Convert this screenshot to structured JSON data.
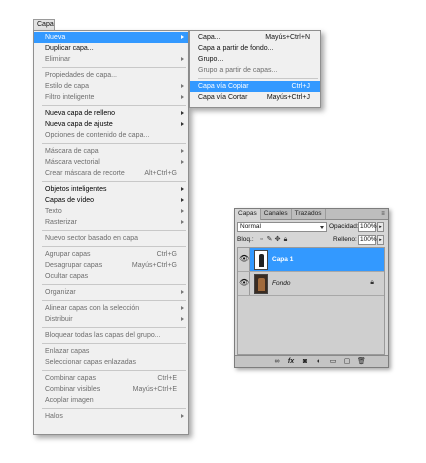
{
  "menubar": {
    "label": "Capa"
  },
  "main_menu": {
    "items": [
      {
        "label": "Nueva",
        "shortcut": "",
        "arrow": true,
        "state": "hl"
      },
      {
        "label": "Duplicar capa...",
        "shortcut": "",
        "arrow": false,
        "state": "enabled"
      },
      {
        "label": "Eliminar",
        "shortcut": "",
        "arrow": true,
        "state": "disabled"
      },
      {
        "sep": true
      },
      {
        "label": "Propiedades de capa...",
        "shortcut": "",
        "arrow": false,
        "state": "disabled"
      },
      {
        "label": "Estilo de capa",
        "shortcut": "",
        "arrow": true,
        "state": "disabled"
      },
      {
        "label": "Filtro inteligente",
        "shortcut": "",
        "arrow": true,
        "state": "disabled"
      },
      {
        "sep": true
      },
      {
        "label": "Nueva capa de relleno",
        "shortcut": "",
        "arrow": true,
        "state": "strong"
      },
      {
        "label": "Nueva capa de ajuste",
        "shortcut": "",
        "arrow": true,
        "state": "strong"
      },
      {
        "label": "Opciones de contenido de capa...",
        "shortcut": "",
        "arrow": false,
        "state": "disabled"
      },
      {
        "sep": true
      },
      {
        "label": "Máscara de capa",
        "shortcut": "",
        "arrow": true,
        "state": "disabled"
      },
      {
        "label": "Máscara vectorial",
        "shortcut": "",
        "arrow": true,
        "state": "disabled"
      },
      {
        "label": "Crear máscara de recorte",
        "shortcut": "Alt+Ctrl+G",
        "arrow": false,
        "state": "disabled"
      },
      {
        "sep": true
      },
      {
        "label": "Objetos inteligentes",
        "shortcut": "",
        "arrow": true,
        "state": "strong"
      },
      {
        "label": "Capas de vídeo",
        "shortcut": "",
        "arrow": true,
        "state": "strong"
      },
      {
        "label": "Texto",
        "shortcut": "",
        "arrow": true,
        "state": "disabled"
      },
      {
        "label": "Rasterizar",
        "shortcut": "",
        "arrow": true,
        "state": "disabled"
      },
      {
        "sep": true
      },
      {
        "label": "Nuevo sector basado en capa",
        "shortcut": "",
        "arrow": false,
        "state": "disabled"
      },
      {
        "sep": true
      },
      {
        "label": "Agrupar capas",
        "shortcut": "Ctrl+G",
        "arrow": false,
        "state": "disabled"
      },
      {
        "label": "Desagrupar capas",
        "shortcut": "Mayús+Ctrl+G",
        "arrow": false,
        "state": "disabled"
      },
      {
        "label": "Ocultar capas",
        "shortcut": "",
        "arrow": false,
        "state": "disabled"
      },
      {
        "sep": true
      },
      {
        "label": "Organizar",
        "shortcut": "",
        "arrow": true,
        "state": "disabled"
      },
      {
        "sep": true
      },
      {
        "label": "Alinear capas con la selección",
        "shortcut": "",
        "arrow": true,
        "state": "disabled"
      },
      {
        "label": "Distribuir",
        "shortcut": "",
        "arrow": true,
        "state": "disabled"
      },
      {
        "sep": true
      },
      {
        "label": "Bloquear todas las capas del grupo...",
        "shortcut": "",
        "arrow": false,
        "state": "disabled"
      },
      {
        "sep": true
      },
      {
        "label": "Enlazar capas",
        "shortcut": "",
        "arrow": false,
        "state": "disabled"
      },
      {
        "label": "Seleccionar capas enlazadas",
        "shortcut": "",
        "arrow": false,
        "state": "disabled"
      },
      {
        "sep": true
      },
      {
        "label": "Combinar capas",
        "shortcut": "Ctrl+E",
        "arrow": false,
        "state": "disabled"
      },
      {
        "label": "Combinar visibles",
        "shortcut": "Mayús+Ctrl+E",
        "arrow": false,
        "state": "disabled"
      },
      {
        "label": "Acoplar imagen",
        "shortcut": "",
        "arrow": false,
        "state": "disabled"
      },
      {
        "sep": true
      },
      {
        "label": "Halos",
        "shortcut": "",
        "arrow": true,
        "state": "disabled"
      }
    ]
  },
  "submenu": {
    "items": [
      {
        "label": "Capa...",
        "shortcut": "Mayús+Ctrl+N",
        "state": "enabled"
      },
      {
        "label": "Capa a partir de fondo...",
        "shortcut": "",
        "state": "enabled"
      },
      {
        "label": "Grupo...",
        "shortcut": "",
        "state": "enabled"
      },
      {
        "label": "Grupo a partir de capas...",
        "shortcut": "",
        "state": "disabled"
      },
      {
        "sep": true
      },
      {
        "label": "Capa vía Copiar",
        "shortcut": "Ctrl+J",
        "state": "hl"
      },
      {
        "label": "Capa vía Cortar",
        "shortcut": "Mayús+Ctrl+J",
        "state": "enabled"
      }
    ]
  },
  "layers_panel": {
    "tabs": [
      "Capas",
      "Canales",
      "Trazados"
    ],
    "active_tab": 0,
    "blend_mode": "Normal",
    "opacity_label": "Opacidad:",
    "opacity_value": "100%",
    "lock_label": "Bloq.:",
    "fill_label": "Relleno:",
    "fill_value": "100%",
    "layers": [
      {
        "name": "Capa 1",
        "selected": true,
        "italic": false,
        "locked": false
      },
      {
        "name": "Fondo",
        "selected": false,
        "italic": true,
        "locked": true
      }
    ],
    "footer_icons": [
      "link-icon",
      "fx-icon",
      "mask-icon",
      "adjustment-icon",
      "group-icon",
      "new-layer-icon",
      "trash-icon"
    ]
  },
  "colors": {
    "highlight": "#3399ff",
    "menu_bg": "#f0f0f0",
    "panel_bg": "#d6d6d6"
  }
}
